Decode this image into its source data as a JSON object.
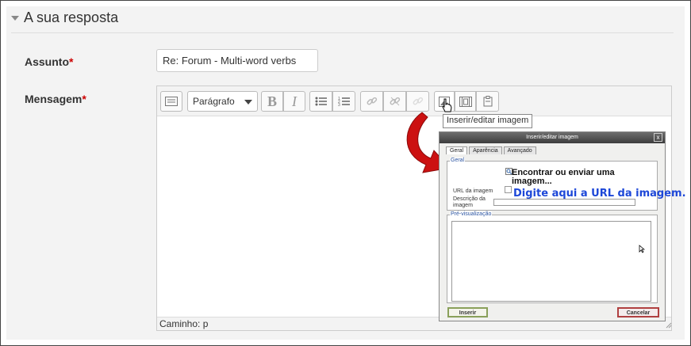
{
  "section": {
    "title": "A sua resposta"
  },
  "form": {
    "subject_label": "Assunto",
    "message_label": "Mensagem",
    "required_marker": "*",
    "subject_value": "Re: Forum - Multi-word verbs"
  },
  "editor": {
    "format_select": "Parágrafo",
    "status_path": "Caminho: p",
    "tooltip": "Inserir/editar imagem"
  },
  "dialog": {
    "title": "Inserir/editar imagem",
    "close": "x",
    "tabs": [
      "Geral",
      "Aparência",
      "Avançado"
    ],
    "general_legend": "Geral",
    "browse_label": "Encontrar ou enviar uma imagem...",
    "url_label": "URL da imagem",
    "hint": "Digite aqui a URL da imagem.",
    "description_label_1": "Descrição da",
    "description_label_2": "imagem",
    "preview_legend": "Pré-visualização",
    "insert_button": "Inserir",
    "cancel_button": "Cancelar"
  },
  "colors": {
    "required": "#cc0000",
    "hint_text": "#1d47d8",
    "arrow": "#cc1111",
    "legend": "#2a53a1"
  }
}
